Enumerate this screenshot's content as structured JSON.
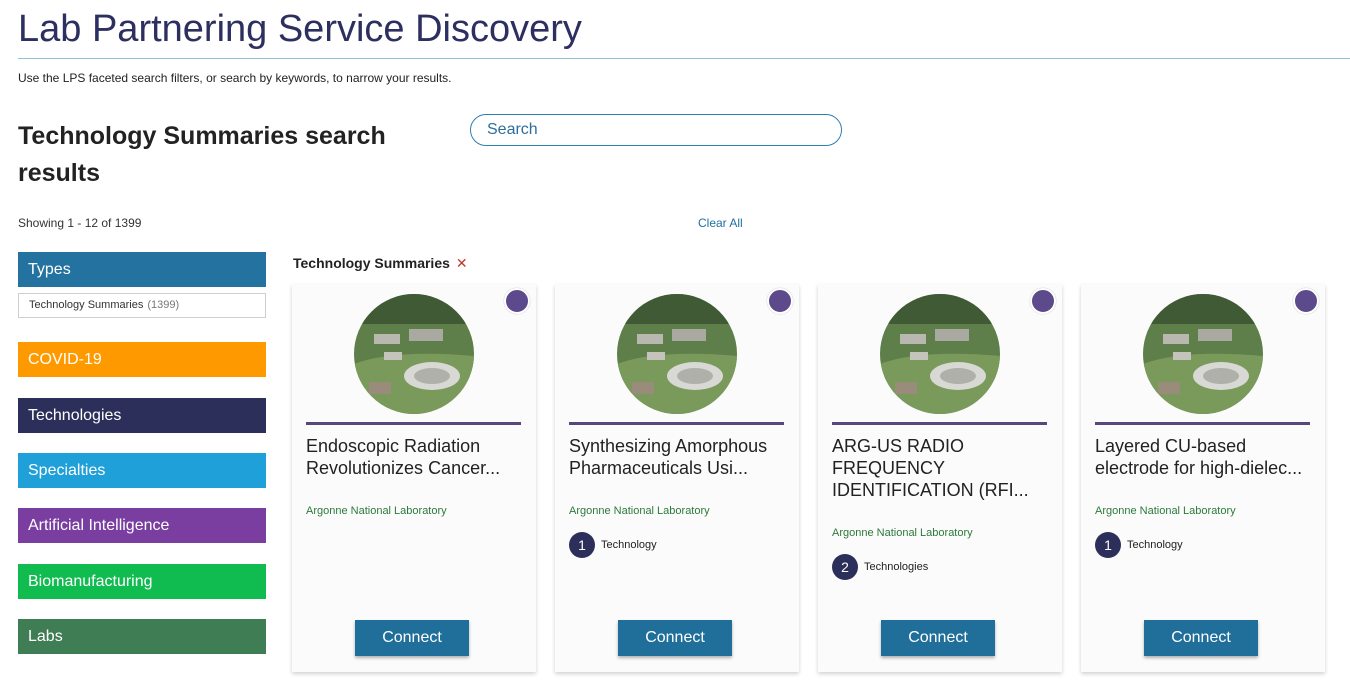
{
  "page": {
    "title": "Lab Partnering Service Discovery",
    "intro": "Use the LPS faceted search filters, or search by keywords, to narrow your results.",
    "results_heading": "Technology Summaries search results",
    "search_placeholder": "Search",
    "showing": "Showing 1 - 12 of 1399",
    "clear_all": "Clear All"
  },
  "facets": [
    {
      "label": "Types",
      "color": "#2372a0"
    },
    {
      "label": "COVID-19",
      "color": "#ff9900"
    },
    {
      "label": "Technologies",
      "color": "#2b2f5a"
    },
    {
      "label": "Specialties",
      "color": "#20a0d8"
    },
    {
      "label": "Artificial Intelligence",
      "color": "#7a3ea0"
    },
    {
      "label": "Biomanufacturing",
      "color": "#10bb50"
    },
    {
      "label": "Labs",
      "color": "#3f7d55"
    }
  ],
  "types_option": {
    "label": "Technology Summaries",
    "count": "(1399)"
  },
  "active_filter": {
    "label": "Technology Summaries",
    "remove_icon": "close-icon"
  },
  "cards": [
    {
      "title": "Endoscopic Radiation Revolutionizes Cancer...",
      "lab": "Argonne National Laboratory",
      "tech_count": "",
      "tech_label": "",
      "connect": "Connect"
    },
    {
      "title": "Synthesizing Amorphous Pharmaceuticals Usi...",
      "lab": "Argonne National Laboratory",
      "tech_count": "1",
      "tech_label": "Technology",
      "connect": "Connect"
    },
    {
      "title": "ARG-US RADIO FREQUENCY IDENTIFICATION (RFI...",
      "lab": "Argonne National Laboratory",
      "tech_count": "2",
      "tech_label": "Technologies",
      "connect": "Connect"
    },
    {
      "title": "Layered CU-based electrode for high-dielec...",
      "lab": "Argonne National Laboratory",
      "tech_count": "1",
      "tech_label": "Technology",
      "connect": "Connect"
    }
  ],
  "colors": {
    "accent": "#2c2f60",
    "card_rule": "#58467f",
    "connect_button": "#1f6f9a",
    "lab_text": "#2c7a3a",
    "card_dot": "#5c4a8c"
  }
}
